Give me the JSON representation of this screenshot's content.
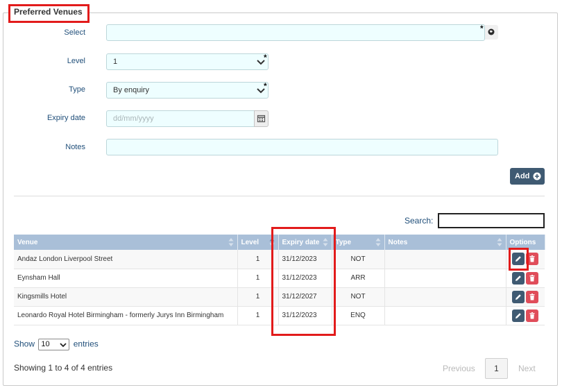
{
  "form": {
    "legend": "Preferred Venues",
    "select_label": "Select",
    "select_value": "",
    "level_label": "Level",
    "level_value": "1",
    "type_label": "Type",
    "type_value": "By enquiry",
    "expiry_label": "Expiry date",
    "expiry_placeholder": "dd/mm/yyyy",
    "notes_label": "Notes",
    "notes_value": "",
    "required_mark": "*",
    "add_button": "Add"
  },
  "search": {
    "label": "Search:",
    "value": ""
  },
  "table": {
    "columns": [
      "Venue",
      "Level",
      "Expiry date",
      "Type",
      "Notes",
      "Options"
    ],
    "rows": [
      {
        "venue": "Andaz London Liverpool Street",
        "level": "1",
        "expiry": "31/12/2023",
        "type": "NOT",
        "type_color": "#d40000",
        "notes": ""
      },
      {
        "venue": "Eynsham Hall",
        "level": "1",
        "expiry": "31/12/2023",
        "type": "ARR",
        "type_color": "#e8a020",
        "notes": ""
      },
      {
        "venue": "Kingsmills Hotel",
        "level": "1",
        "expiry": "31/12/2027",
        "type": "NOT",
        "type_color": "#d40000",
        "notes": ""
      },
      {
        "venue": "Leonardo Royal Hotel Birmingham - formerly Jurys Inn Birmingham",
        "level": "1",
        "expiry": "31/12/2023",
        "type": "ENQ",
        "type_color": "#2a8a2a",
        "notes": ""
      }
    ]
  },
  "length_menu": {
    "show": "Show",
    "value": "10",
    "entries": "entries"
  },
  "info": "Showing 1 to 4 of 4 entries",
  "pagination": {
    "previous": "Previous",
    "current": "1",
    "next": "Next"
  },
  "colors": {
    "header_bg": "#a9bfd8",
    "button_dark": "#3f5a72",
    "delete_red": "#e04d5a",
    "highlight": "#e21b1b",
    "field_bg": "#eefeff"
  }
}
